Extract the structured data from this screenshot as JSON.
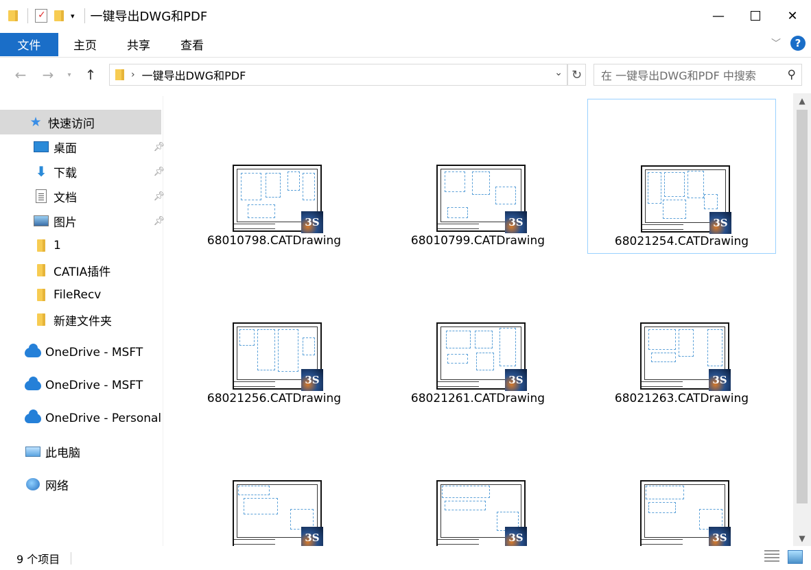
{
  "window": {
    "title": "一键导出DWG和PDF",
    "minimize_glyph": "—",
    "close_glyph": "✕"
  },
  "ribbon": {
    "tabs": [
      "文件",
      "主页",
      "共享",
      "查看"
    ],
    "accent_color": "#1a6ec8",
    "help_glyph": "?",
    "expand_glyph": "﹀"
  },
  "address": {
    "path": "一键导出DWG和PDF",
    "search_placeholder": "在 一键导出DWG和PDF 中搜索"
  },
  "nav": {
    "quick_access": "快速访问",
    "pinned": [
      {
        "label": "桌面",
        "icon": "desktop-icon"
      },
      {
        "label": "下载",
        "icon": "download-icon"
      },
      {
        "label": "文档",
        "icon": "document-icon"
      },
      {
        "label": "图片",
        "icon": "pictures-icon"
      }
    ],
    "folders": [
      "1",
      "CATIA插件",
      "FileRecv",
      "新建文件夹"
    ],
    "onedrive": [
      "OneDrive - MSFT",
      "OneDrive - MSFT",
      "OneDrive - Personal"
    ],
    "this_pc": "此电脑",
    "network": "网络"
  },
  "files": [
    {
      "name": "68010798.CATDrawing",
      "selected": false
    },
    {
      "name": "68010799.CATDrawing",
      "selected": false
    },
    {
      "name": "68021254.CATDrawing",
      "selected": true
    },
    {
      "name": "68021256.CATDrawing",
      "selected": false
    },
    {
      "name": "68021261.CATDrawing",
      "selected": false
    },
    {
      "name": "68021263.CATDrawing",
      "selected": false
    },
    {
      "name": "",
      "selected": false
    },
    {
      "name": "",
      "selected": false
    },
    {
      "name": "",
      "selected": false
    }
  ],
  "badge_glyph": "3S",
  "status": {
    "item_count": "9 个项目"
  }
}
